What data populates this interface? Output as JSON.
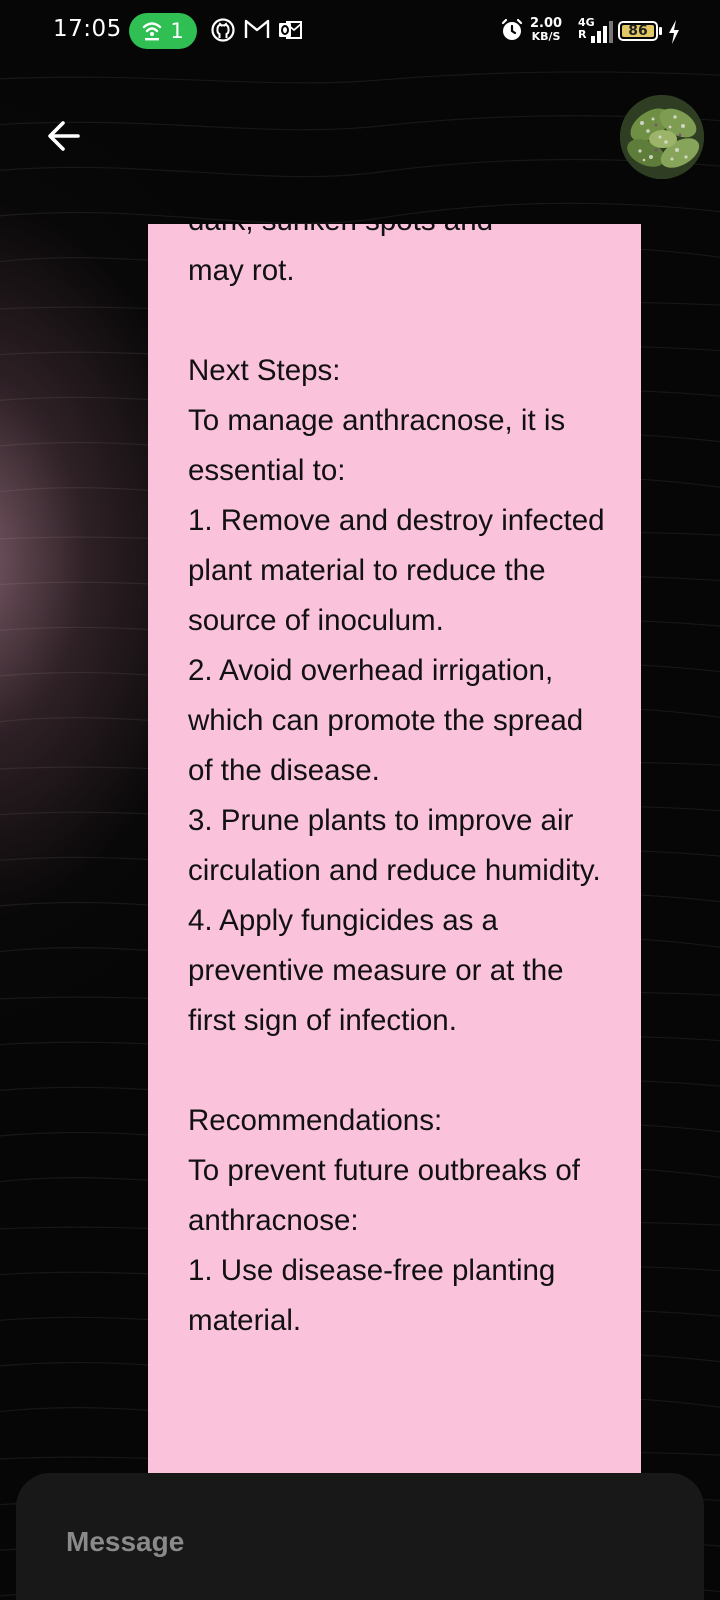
{
  "status_bar": {
    "time": "17:05",
    "hotspot_count": "1",
    "net_speed_value": "2.00",
    "net_speed_unit": "KB/S",
    "network_type": "4G",
    "roaming": "R",
    "battery_level": "86",
    "icons": [
      "hotspot-icon",
      "github-icon",
      "gmail-icon",
      "outlook-icon",
      "alarm-icon",
      "signal-icon",
      "battery-icon",
      "charging-icon"
    ]
  },
  "header": {
    "back_icon": "arrow-left-icon",
    "avatar": "plant-leaf-avatar"
  },
  "message": {
    "partial_top_line": "dark, sunken spots and",
    "text": "may rot.\n\nNext Steps:\nTo manage anthracnose, it is essential to:\n1. Remove and destroy infected plant material to reduce the source of inoculum.\n2. Avoid overhead irrigation, which can promote the spread of the disease.\n3. Prune plants to improve air circulation and reduce humidity.\n4. Apply fungicides as a preventive measure or at the first sign of infection.\n\nRecommendations:\nTo prevent future outbreaks of anthracnose:\n1. Use disease-free planting material.",
    "background_color": "#fbc2dc"
  },
  "composer": {
    "placeholder": "Message",
    "value": ""
  }
}
